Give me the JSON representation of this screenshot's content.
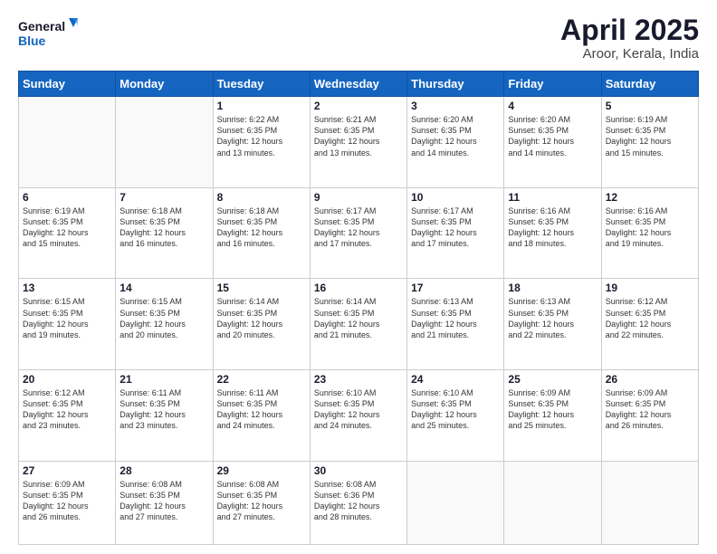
{
  "header": {
    "logo_line1": "General",
    "logo_line2": "Blue",
    "title": "April 2025",
    "subtitle": "Aroor, Kerala, India"
  },
  "days_of_week": [
    "Sunday",
    "Monday",
    "Tuesday",
    "Wednesday",
    "Thursday",
    "Friday",
    "Saturday"
  ],
  "weeks": [
    [
      {
        "day": "",
        "info": ""
      },
      {
        "day": "",
        "info": ""
      },
      {
        "day": "1",
        "info": "Sunrise: 6:22 AM\nSunset: 6:35 PM\nDaylight: 12 hours\nand 13 minutes."
      },
      {
        "day": "2",
        "info": "Sunrise: 6:21 AM\nSunset: 6:35 PM\nDaylight: 12 hours\nand 13 minutes."
      },
      {
        "day": "3",
        "info": "Sunrise: 6:20 AM\nSunset: 6:35 PM\nDaylight: 12 hours\nand 14 minutes."
      },
      {
        "day": "4",
        "info": "Sunrise: 6:20 AM\nSunset: 6:35 PM\nDaylight: 12 hours\nand 14 minutes."
      },
      {
        "day": "5",
        "info": "Sunrise: 6:19 AM\nSunset: 6:35 PM\nDaylight: 12 hours\nand 15 minutes."
      }
    ],
    [
      {
        "day": "6",
        "info": "Sunrise: 6:19 AM\nSunset: 6:35 PM\nDaylight: 12 hours\nand 15 minutes."
      },
      {
        "day": "7",
        "info": "Sunrise: 6:18 AM\nSunset: 6:35 PM\nDaylight: 12 hours\nand 16 minutes."
      },
      {
        "day": "8",
        "info": "Sunrise: 6:18 AM\nSunset: 6:35 PM\nDaylight: 12 hours\nand 16 minutes."
      },
      {
        "day": "9",
        "info": "Sunrise: 6:17 AM\nSunset: 6:35 PM\nDaylight: 12 hours\nand 17 minutes."
      },
      {
        "day": "10",
        "info": "Sunrise: 6:17 AM\nSunset: 6:35 PM\nDaylight: 12 hours\nand 17 minutes."
      },
      {
        "day": "11",
        "info": "Sunrise: 6:16 AM\nSunset: 6:35 PM\nDaylight: 12 hours\nand 18 minutes."
      },
      {
        "day": "12",
        "info": "Sunrise: 6:16 AM\nSunset: 6:35 PM\nDaylight: 12 hours\nand 19 minutes."
      }
    ],
    [
      {
        "day": "13",
        "info": "Sunrise: 6:15 AM\nSunset: 6:35 PM\nDaylight: 12 hours\nand 19 minutes."
      },
      {
        "day": "14",
        "info": "Sunrise: 6:15 AM\nSunset: 6:35 PM\nDaylight: 12 hours\nand 20 minutes."
      },
      {
        "day": "15",
        "info": "Sunrise: 6:14 AM\nSunset: 6:35 PM\nDaylight: 12 hours\nand 20 minutes."
      },
      {
        "day": "16",
        "info": "Sunrise: 6:14 AM\nSunset: 6:35 PM\nDaylight: 12 hours\nand 21 minutes."
      },
      {
        "day": "17",
        "info": "Sunrise: 6:13 AM\nSunset: 6:35 PM\nDaylight: 12 hours\nand 21 minutes."
      },
      {
        "day": "18",
        "info": "Sunrise: 6:13 AM\nSunset: 6:35 PM\nDaylight: 12 hours\nand 22 minutes."
      },
      {
        "day": "19",
        "info": "Sunrise: 6:12 AM\nSunset: 6:35 PM\nDaylight: 12 hours\nand 22 minutes."
      }
    ],
    [
      {
        "day": "20",
        "info": "Sunrise: 6:12 AM\nSunset: 6:35 PM\nDaylight: 12 hours\nand 23 minutes."
      },
      {
        "day": "21",
        "info": "Sunrise: 6:11 AM\nSunset: 6:35 PM\nDaylight: 12 hours\nand 23 minutes."
      },
      {
        "day": "22",
        "info": "Sunrise: 6:11 AM\nSunset: 6:35 PM\nDaylight: 12 hours\nand 24 minutes."
      },
      {
        "day": "23",
        "info": "Sunrise: 6:10 AM\nSunset: 6:35 PM\nDaylight: 12 hours\nand 24 minutes."
      },
      {
        "day": "24",
        "info": "Sunrise: 6:10 AM\nSunset: 6:35 PM\nDaylight: 12 hours\nand 25 minutes."
      },
      {
        "day": "25",
        "info": "Sunrise: 6:09 AM\nSunset: 6:35 PM\nDaylight: 12 hours\nand 25 minutes."
      },
      {
        "day": "26",
        "info": "Sunrise: 6:09 AM\nSunset: 6:35 PM\nDaylight: 12 hours\nand 26 minutes."
      }
    ],
    [
      {
        "day": "27",
        "info": "Sunrise: 6:09 AM\nSunset: 6:35 PM\nDaylight: 12 hours\nand 26 minutes."
      },
      {
        "day": "28",
        "info": "Sunrise: 6:08 AM\nSunset: 6:35 PM\nDaylight: 12 hours\nand 27 minutes."
      },
      {
        "day": "29",
        "info": "Sunrise: 6:08 AM\nSunset: 6:35 PM\nDaylight: 12 hours\nand 27 minutes."
      },
      {
        "day": "30",
        "info": "Sunrise: 6:08 AM\nSunset: 6:36 PM\nDaylight: 12 hours\nand 28 minutes."
      },
      {
        "day": "",
        "info": ""
      },
      {
        "day": "",
        "info": ""
      },
      {
        "day": "",
        "info": ""
      }
    ]
  ]
}
